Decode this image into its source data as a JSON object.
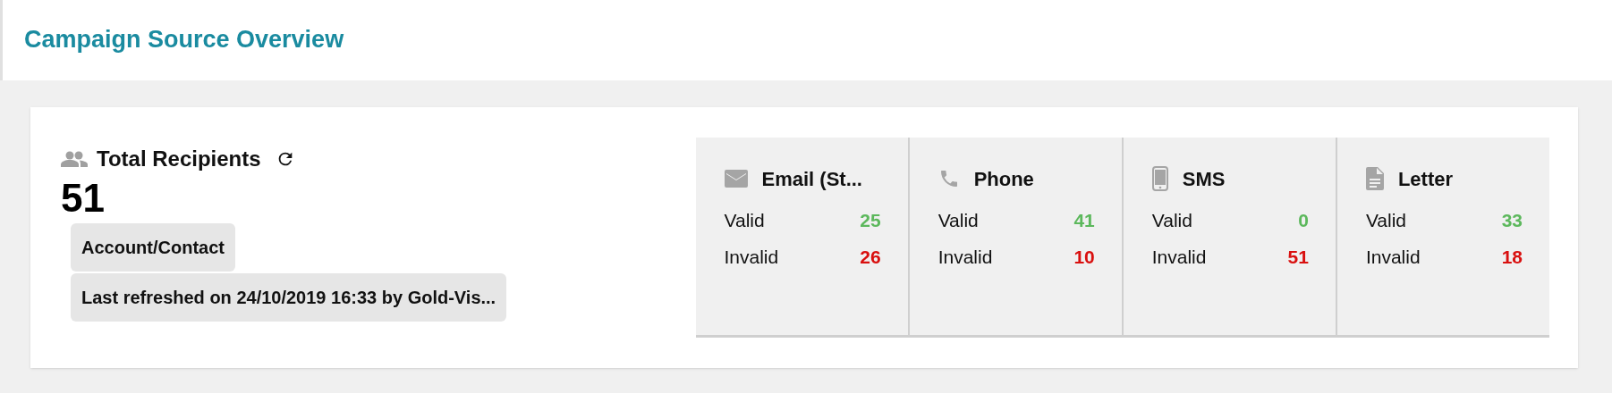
{
  "title": "Campaign Source Overview",
  "summary": {
    "label": "Total Recipients",
    "count": "51",
    "tags": [
      "Account/Contact",
      "Last refreshed on 24/10/2019 16:33 by Gold-Vis..."
    ]
  },
  "channels": [
    {
      "kind": "email",
      "name": "Email (St...",
      "rows": [
        {
          "kind": "valid",
          "label": "Valid",
          "value": "25"
        },
        {
          "kind": "invalid",
          "label": "Invalid",
          "value": "26"
        }
      ]
    },
    {
      "kind": "phone",
      "name": "Phone",
      "rows": [
        {
          "kind": "valid",
          "label": "Valid",
          "value": "41"
        },
        {
          "kind": "invalid",
          "label": "Invalid",
          "value": "10"
        }
      ]
    },
    {
      "kind": "sms",
      "name": "SMS",
      "rows": [
        {
          "kind": "valid",
          "label": "Valid",
          "value": "0"
        },
        {
          "kind": "invalid",
          "label": "Invalid",
          "value": "51"
        }
      ]
    },
    {
      "kind": "letter",
      "name": "Letter",
      "rows": [
        {
          "kind": "valid",
          "label": "Valid",
          "value": "33"
        },
        {
          "kind": "invalid",
          "label": "Invalid",
          "value": "18"
        }
      ]
    }
  ]
}
